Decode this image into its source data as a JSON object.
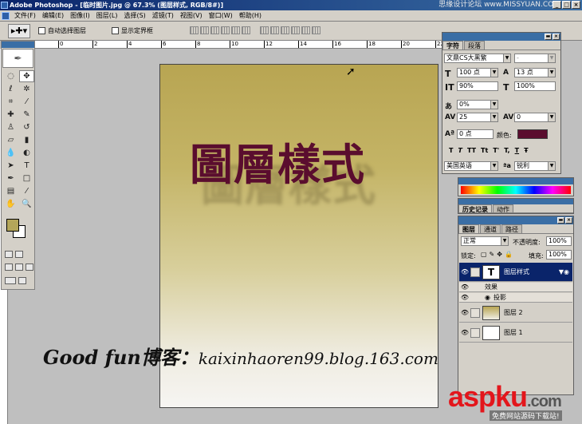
{
  "window": {
    "title": "Adobe Photoshop - [临时图片.jpg @ 67.3% (图层样式, RGB/8#)]",
    "watermark": "思缘设计论坛 www.MISSYUAN.COM",
    "controls": [
      "_",
      "□",
      "×"
    ]
  },
  "menu": [
    "文件(F)",
    "编辑(E)",
    "图像(I)",
    "图层(L)",
    "选择(S)",
    "滤镜(T)",
    "视图(V)",
    "窗口(W)",
    "帮助(H)"
  ],
  "options_bar": {
    "auto_select": "自动选择图层",
    "show_bounds": "显示定界框"
  },
  "ruler": {
    "labels": [
      "2",
      "0",
      "2",
      "4",
      "6",
      "8",
      "10",
      "12",
      "14",
      "16",
      "18",
      "20",
      "22"
    ]
  },
  "canvas": {
    "heading": "圖層樣式",
    "caption_left": "Good fun博客：",
    "caption_url": "kaixinhaoren99.blog.163.com"
  },
  "character_panel": {
    "tabs": [
      "字符",
      "段落"
    ],
    "font": "文鼎CS大黑繁",
    "font_style": "-",
    "size": "100 点",
    "leading": "13 点",
    "vscale": "90%",
    "hscale": "100%",
    "tracking_pct": "0%",
    "kerning": "25",
    "tracking": "0",
    "baseline": "0 点",
    "color_label": "颜色:",
    "styles": [
      "T",
      "T",
      "TT",
      "Tt",
      "T'",
      "T,",
      "T",
      "Ŧ"
    ],
    "language": "美国英语",
    "aa_label": "ªa",
    "antialias": "锐利",
    "colors": {
      "text": "#5a0d2e"
    }
  },
  "history_panel": {
    "tabs": [
      "历史记录",
      "动作"
    ]
  },
  "layers_panel": {
    "tabs": [
      "图层",
      "通道",
      "路径"
    ],
    "blend_mode": "正常",
    "opacity_label": "不透明度:",
    "opacity": "100%",
    "lock_label": "锁定:",
    "fill_label": "填充:",
    "fill": "100%",
    "layers": [
      {
        "name": "图层样式",
        "type": "text"
      },
      {
        "name": "效果",
        "type": "effect-header"
      },
      {
        "name": "投影",
        "type": "effect"
      },
      {
        "name": "图层 2",
        "type": "gradient"
      },
      {
        "name": "图层 1",
        "type": "white"
      }
    ]
  },
  "brand": {
    "logo_main": "aspku",
    "logo_domain": ".com",
    "slogan": "免费网站源码下载站!"
  }
}
